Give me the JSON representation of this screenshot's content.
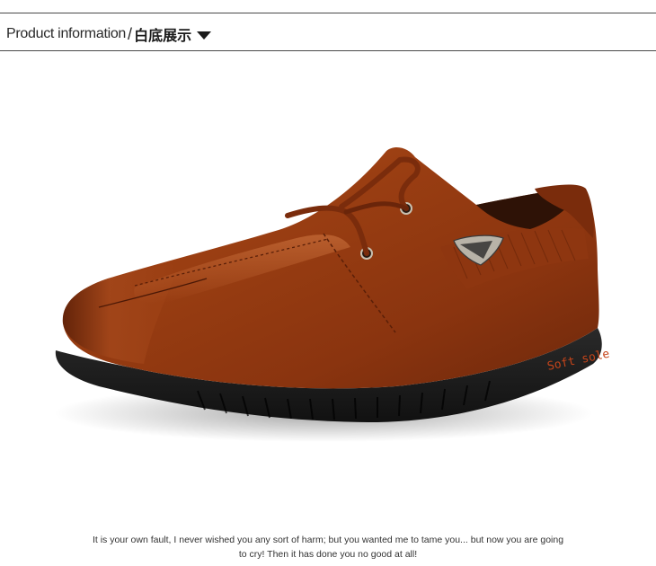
{
  "header": {
    "title_en": "Product information",
    "separator": "/",
    "title_cn": "白底展示",
    "arrow_icon": "triangle-down-icon"
  },
  "product_image": {
    "sole_print": "Soft sole",
    "colors": {
      "leather": "#8a3410",
      "sole": "#1c1c1c",
      "sole_text": "#c4441a"
    }
  },
  "caption": {
    "line1": "It is your own fault, I never wished you any sort of harm; but you wanted me to tame you... but now you are going",
    "line2": "to cry! Then it has done you no good at all!"
  }
}
